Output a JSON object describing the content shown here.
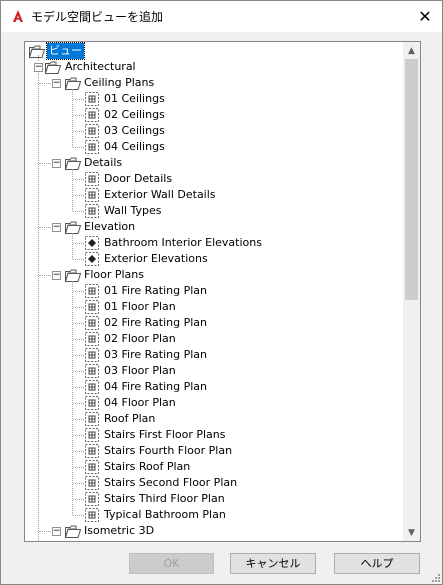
{
  "window": {
    "title": "モデル空間ビューを追加",
    "close_glyph": "✕"
  },
  "tree": {
    "root": {
      "label": "ビュー"
    },
    "architectural": {
      "label": "Architectural"
    },
    "groups": [
      {
        "label": "Ceiling Plans",
        "items": [
          "01 Ceilings",
          "02 Ceilings",
          "03 Ceilings",
          "04 Ceilings"
        ]
      },
      {
        "label": "Details",
        "items": [
          "Door Details",
          "Exterior Wall Details",
          "Wall Types"
        ]
      },
      {
        "label": "Elevation",
        "items": [
          "Bathroom Interior Elevations",
          "Exterior Elevations"
        ]
      },
      {
        "label": "Floor Plans",
        "items": [
          "01 Fire Rating Plan",
          "01 Floor Plan",
          "02 Fire Rating Plan",
          "02 Floor Plan",
          "03 Fire Rating Plan",
          "03 Floor Plan",
          "04 Fire Rating Plan",
          "04 Floor Plan",
          "Roof Plan",
          "Stairs First Floor Plans",
          "Stairs Fourth Floor Plan",
          "Stairs Roof Plan",
          "Stairs Second Floor Plan",
          "Stairs Third Floor Plan",
          "Typical Bathroom Plan"
        ]
      },
      {
        "label": "Isometric 3D",
        "items": []
      }
    ],
    "expander_glyph": "−"
  },
  "scrollbar": {
    "up_glyph": "▲",
    "down_glyph": "▼"
  },
  "buttons": {
    "ok": "OK",
    "cancel": "キャンセル",
    "help": "ヘルプ"
  },
  "colors": {
    "selection": "#0078d7",
    "app_icon": "#d42020"
  }
}
